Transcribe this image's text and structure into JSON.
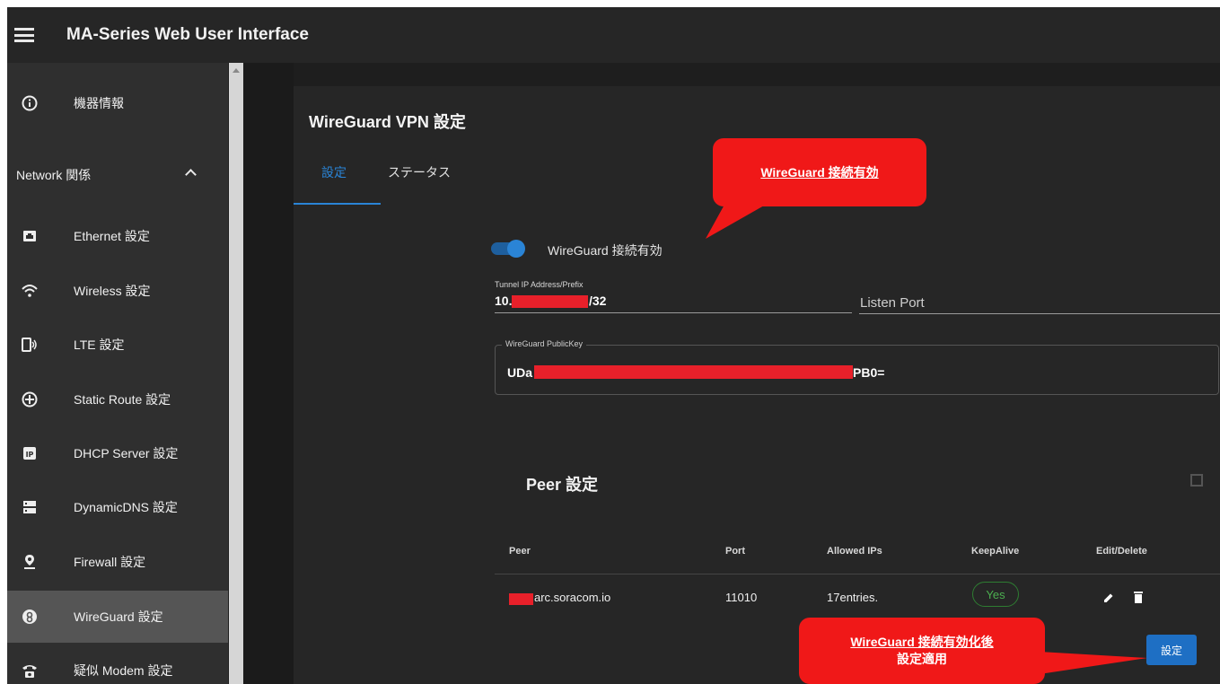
{
  "app": {
    "title": "MA-Series Web User Interface"
  },
  "sidebar": {
    "device_info": "機器情報",
    "network_group": "Network 関係",
    "items": [
      {
        "label": "Ethernet 設定",
        "icon": "ethernet-icon"
      },
      {
        "label": "Wireless 設定",
        "icon": "wifi-icon"
      },
      {
        "label": "LTE 設定",
        "icon": "lte-icon"
      },
      {
        "label": "Static Route 設定",
        "icon": "route-icon"
      },
      {
        "label": "DHCP Server 設定",
        "icon": "ip-icon"
      },
      {
        "label": "DynamicDNS 設定",
        "icon": "dns-icon"
      },
      {
        "label": "Firewall 設定",
        "icon": "firewall-icon"
      },
      {
        "label": "WireGuard 設定",
        "icon": "wireguard-icon",
        "active": true
      },
      {
        "label": "疑似 Modem 設定",
        "icon": "phone-icon"
      }
    ]
  },
  "main": {
    "title": "WireGuard VPN 設定",
    "tabs": [
      {
        "label": "設定",
        "active": true
      },
      {
        "label": "ステータス"
      }
    ],
    "toggle": {
      "label": "WireGuard 接続有効",
      "on": true
    },
    "tunnel": {
      "label": "Tunnel IP Address/Prefix",
      "value_prefix": "10.",
      "value_suffix": "/32"
    },
    "listen_port": {
      "placeholder": "Listen Port"
    },
    "public_key": {
      "label": "WireGuard PublicKey",
      "value_prefix": "UDa",
      "value_suffix": "PB0="
    },
    "peer": {
      "title": "Peer 設定",
      "headers": [
        "Peer",
        "Port",
        "Allowed IPs",
        "KeepAlive",
        "Edit/Delete"
      ],
      "rows": [
        {
          "peer": "arc.soracom.io",
          "port": "11010",
          "allowed_ips": "17entries.",
          "keepalive": "Yes"
        }
      ]
    },
    "submit_label": "設定"
  },
  "callouts": {
    "top": "WireGuard 接続有効",
    "bottom_line1": "WireGuard 接続有効化後",
    "bottom_line2": "設定適用"
  },
  "colors": {
    "accent": "#2a84d6",
    "callout": "#f01818",
    "redaction": "#e8202a",
    "keepalive": "#4caf50"
  }
}
